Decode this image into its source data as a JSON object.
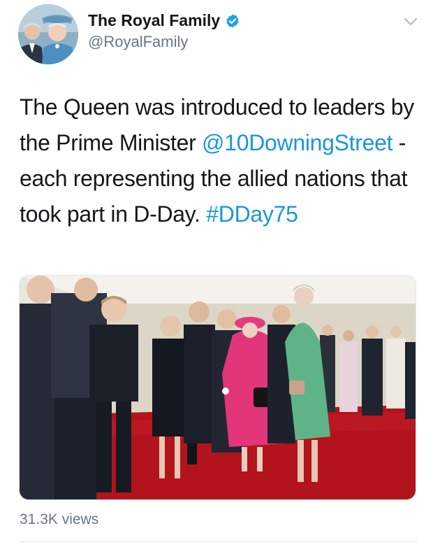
{
  "header": {
    "display_name": "The Royal Family",
    "handle": "@RoyalFamily"
  },
  "tweet": {
    "text_part1": "The Queen was introduced to leaders by the Prime Minister ",
    "mention": "@10DowningStreet",
    "text_part2": " - each representing the allied nations that took part in D-Day. ",
    "hashtag": "#DDay75"
  },
  "media": {
    "description": "Photo of the Queen greeting leaders in a marquee with red carpet"
  },
  "footer": {
    "views": "31.3K views"
  },
  "colors": {
    "link": "#1b95e0",
    "verified": "#1da1f2",
    "secondary_text": "#657786"
  },
  "icons": [
    "verified-badge-icon",
    "chevron-down-icon"
  ]
}
